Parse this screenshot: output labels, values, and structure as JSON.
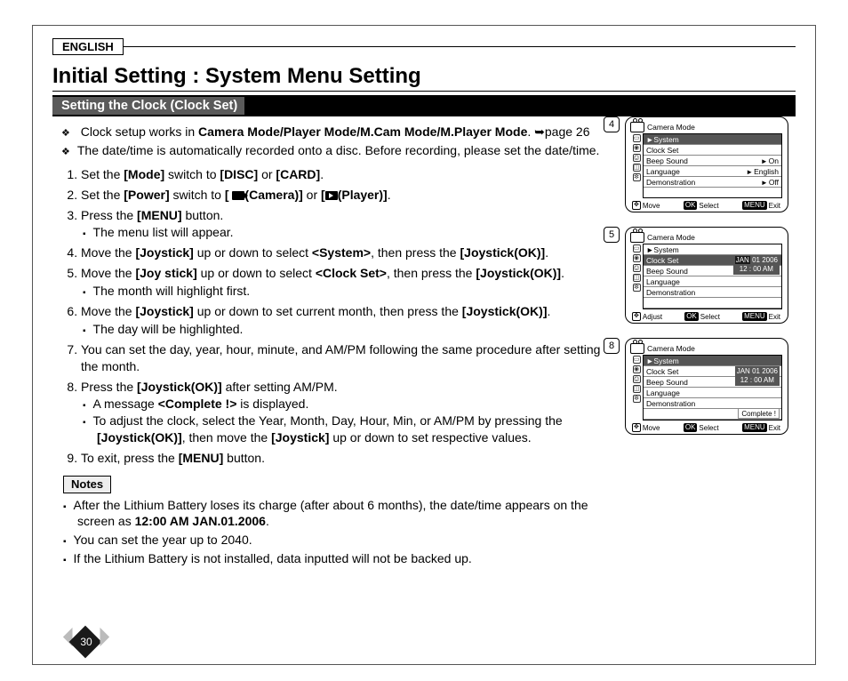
{
  "lang": "ENGLISH",
  "title": "Initial Setting : System Menu Setting",
  "section": "Setting the Clock (Clock Set)",
  "page_ref": "page 26",
  "intro": [
    "Clock setup works in ",
    "The date/time is automatically recorded onto a disc. Before recording, please set the date/time."
  ],
  "modes": "Camera Mode/Player Mode/M.Cam Mode/M.Player Mode",
  "steps": {
    "s1a": "Set the ",
    "s1b": "[Mode]",
    "s1c": " switch to ",
    "s1d": "[DISC]",
    "s1e": " or ",
    "s1f": "[CARD]",
    "s1g": ".",
    "s2a": "Set the ",
    "s2b": "[Power]",
    "s2c": " switch to ",
    "s2d": "[",
    "s2e": "(Camera)]",
    "s2f": " or ",
    "s2g": "[",
    "s2h": "(Player)]",
    "s2i": ".",
    "s3a": "Press the ",
    "s3b": "[MENU]",
    "s3c": " button.",
    "s3sub": "The menu list will appear.",
    "s4a": "Move the ",
    "s4b": "[Joystick]",
    "s4c": " up or down to select ",
    "s4d": "<System>",
    "s4e": ", then press the ",
    "s4f": "[Joystick(OK)]",
    "s4g": ".",
    "s5a": "Move the ",
    "s5b": "[Joy stick]",
    "s5c": " up or down to select ",
    "s5d": "<Clock Set>",
    "s5e": ", then press the ",
    "s5f": "[Joystick(OK)]",
    "s5g": ".",
    "s5sub": "The month will highlight first.",
    "s6a": "Move the ",
    "s6b": "[Joystick]",
    "s6c": " up or down to set current month, then press the ",
    "s6d": "[Joystick(OK)]",
    "s6e": ".",
    "s6sub": "The day will be highlighted.",
    "s7": "You can set the day, year, hour, minute, and AM/PM following the same procedure after setting the month.",
    "s8a": "Press the ",
    "s8b": "[Joystick(OK)]",
    "s8c": " after setting AM/PM.",
    "s8sub1a": "A message ",
    "s8sub1b": "<Complete !>",
    "s8sub1c": " is displayed.",
    "s8sub2a": "To adjust the clock, select the Year, Month, Day, Hour, Min, or AM/PM by pressing the ",
    "s8sub2b": "[Joystick(OK)]",
    "s8sub2c": ", then move the ",
    "s8sub2d": "[Joystick]",
    "s8sub2e": " up or down to set respective values.",
    "s9a": "To exit, press the ",
    "s9b": "[MENU]",
    "s9c": " button."
  },
  "notes_hdr": "Notes",
  "notes": {
    "n1a": "After the Lithium Battery loses its charge (after about 6 months), the date/time appears on the screen as ",
    "n1b": "12:00 AM JAN.01.2006",
    "n1c": ".",
    "n2": "You can set the year up to 2040.",
    "n3": "If the Lithium Battery is not installed, data inputted will not be backed up."
  },
  "page_number": "30",
  "panels": {
    "badges": [
      "4",
      "5",
      "8"
    ],
    "mode_label": "Camera Mode",
    "menu": {
      "system": "System",
      "clock_set": "Clock Set",
      "beep": "Beep Sound",
      "lang": "Language",
      "demo": "Demonstration",
      "on": "On",
      "english": "English",
      "off": "Off"
    },
    "date": {
      "month": "JAN",
      "day": "01",
      "year": "2006",
      "time": "12 : 00  AM"
    },
    "complete": "Complete !",
    "footer": {
      "move": "Move",
      "adjust": "Adjust",
      "ok": "OK",
      "select": "Select",
      "menu": "MENU",
      "exit": "Exit"
    }
  }
}
